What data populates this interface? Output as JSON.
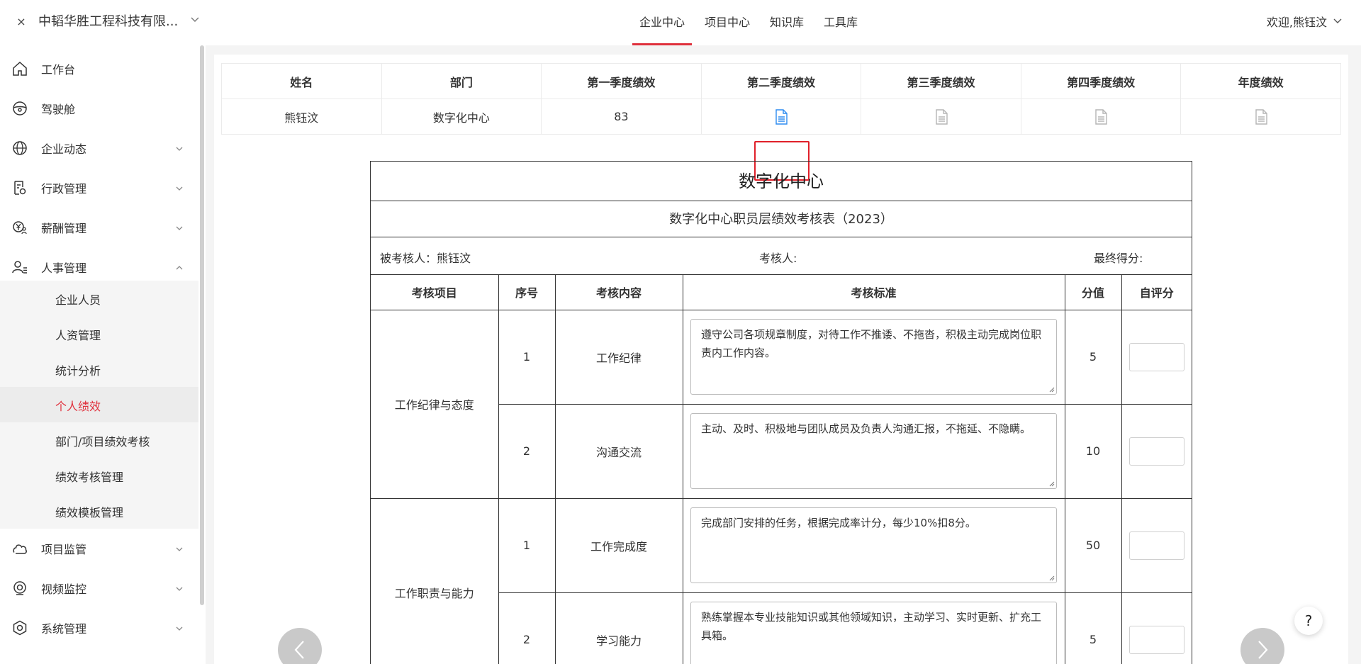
{
  "header": {
    "close_glyph": "×",
    "company": "中韬华胜工程科技有限...",
    "nav_tabs": [
      {
        "label": "企业中心",
        "active": true
      },
      {
        "label": "项目中心",
        "active": false
      },
      {
        "label": "知识库",
        "active": false
      },
      {
        "label": "工具库",
        "active": false
      }
    ],
    "welcome": "欢迎,熊钰汶"
  },
  "sidebar": {
    "items": [
      {
        "label": "工作台",
        "icon": "home-icon"
      },
      {
        "label": "驾驶舱",
        "icon": "steering-wheel-icon"
      },
      {
        "label": "企业动态",
        "icon": "globe-icon",
        "chevron": "down"
      },
      {
        "label": "行政管理",
        "icon": "document-gear-icon",
        "chevron": "down"
      },
      {
        "label": "薪酬管理",
        "icon": "yuan-person-icon",
        "chevron": "down"
      },
      {
        "label": "人事管理",
        "icon": "person-list-icon",
        "chevron": "up"
      },
      {
        "label": "项目监管",
        "icon": "cloud-icon",
        "chevron": "down"
      },
      {
        "label": "视频监控",
        "icon": "camera-icon",
        "chevron": "down"
      },
      {
        "label": "系统管理",
        "icon": "settings-hex-icon",
        "chevron": "down"
      }
    ],
    "sub_items": [
      {
        "label": "企业人员",
        "active": false
      },
      {
        "label": "人资管理",
        "active": false
      },
      {
        "label": "统计分析",
        "active": false
      },
      {
        "label": "个人绩效",
        "active": true
      },
      {
        "label": "部门/项目绩效考核",
        "active": false
      },
      {
        "label": "绩效考核管理",
        "active": false
      },
      {
        "label": "绩效模板管理",
        "active": false
      }
    ]
  },
  "summary": {
    "headers": [
      "姓名",
      "部门",
      "第一季度绩效",
      "第二季度绩效",
      "第三季度绩效",
      "第四季度绩效",
      "年度绩效"
    ],
    "row": {
      "name": "熊钰汶",
      "dept": "数字化中心",
      "q1": "83"
    }
  },
  "form": {
    "title": "数字化中心",
    "subtitle": "数字化中心职员层绩效考核表（2023）",
    "assessee": "被考核人：熊钰汶",
    "assessor": "考核人:",
    "final_score": "最终得分:",
    "columns": [
      "考核项目",
      "序号",
      "考核内容",
      "考核标准",
      "分值",
      "自评分"
    ],
    "rows": [
      {
        "category": "工作纪律与态度",
        "no": "1",
        "content": "工作纪律",
        "criteria": "遵守公司各项规章制度，对待工作不推诿、不拖沓，积极主动完成岗位职责内工作内容。",
        "score": "5"
      },
      {
        "category": "",
        "no": "2",
        "content": "沟通交流",
        "criteria": "主动、及时、积极地与团队成员及负责人沟通汇报，不拖延、不隐瞒。",
        "score": "10"
      },
      {
        "category": "工作职责与能力",
        "no": "1",
        "content": "工作完成度",
        "criteria": "完成部门安排的任务，根据完成率计分，每少10%扣8分。",
        "score": "50"
      },
      {
        "category": "",
        "no": "2",
        "content": "学习能力",
        "criteria": "熟练掌握本专业技能知识或其他领域知识，主动学习、实时更新、扩充工具箱。",
        "score": "5"
      }
    ]
  },
  "help_glyph": "?",
  "colors": {
    "accent": "#e0303c",
    "doc_icon_active": "#2d8cf0",
    "doc_icon_inactive": "#b5b5b5"
  }
}
